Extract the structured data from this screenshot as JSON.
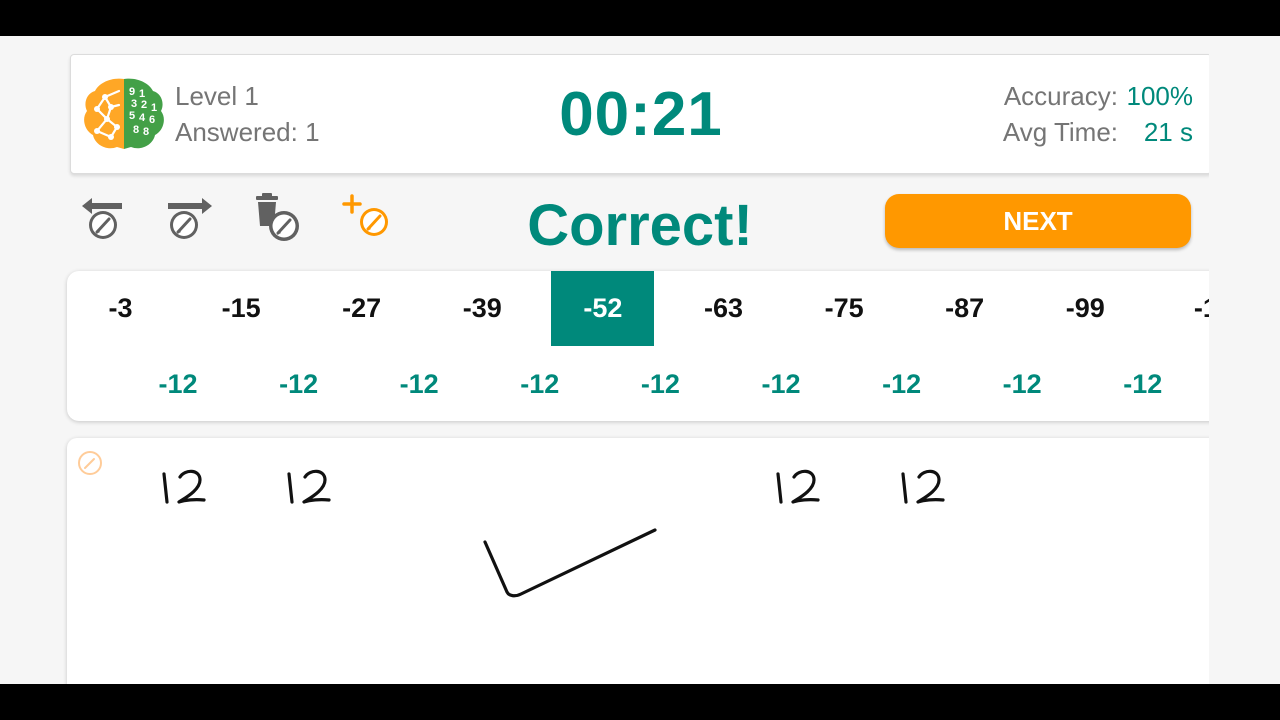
{
  "header": {
    "level": "Level 1",
    "answered": "Answered: 1",
    "timer": "00:21",
    "accuracy_label": "Accuracy:",
    "accuracy_value": "100%",
    "avg_time_label": "Avg Time:",
    "avg_time_value": "21 s",
    "logo_icon": "brain-numbers-logo"
  },
  "toolbar": {
    "undo_icon": "undo-pen-icon",
    "redo_icon": "redo-pen-icon",
    "clear_icon": "clear-drawing-icon",
    "new_pen_icon": "add-pen-icon",
    "result": "Correct!",
    "next_label": "NEXT"
  },
  "sequence": {
    "terms": [
      "-3",
      "-15",
      "-27",
      "-39",
      "-52",
      "-63",
      "-75",
      "-87",
      "-99",
      "-1"
    ],
    "active_index": 4,
    "differences": [
      "-12",
      "-12",
      "-12",
      "-12",
      "-12",
      "-12",
      "-12",
      "-12",
      "-12"
    ]
  },
  "colors": {
    "accent": "#00897b",
    "button": "#ff9800",
    "text_gray": "#757575",
    "pen_icon_orange": "#ff9800"
  }
}
